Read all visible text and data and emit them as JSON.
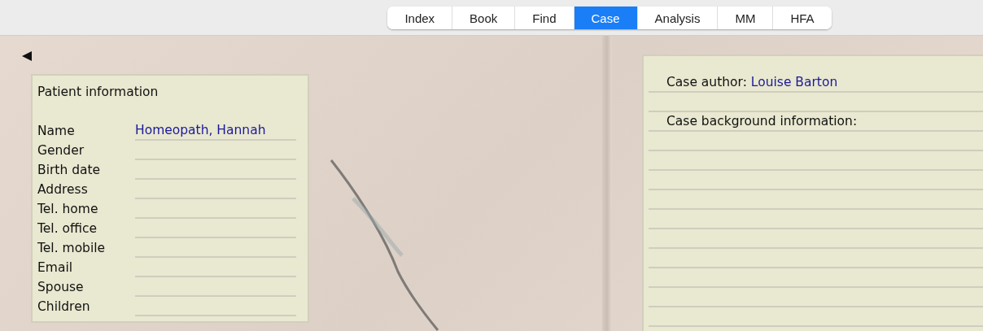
{
  "tabs": [
    {
      "label": "Index",
      "selected": false
    },
    {
      "label": "Book",
      "selected": false
    },
    {
      "label": "Find",
      "selected": false
    },
    {
      "label": "Case",
      "selected": true
    },
    {
      "label": "Analysis",
      "selected": false
    },
    {
      "label": "MM",
      "selected": false
    },
    {
      "label": "HFA",
      "selected": false
    }
  ],
  "patient_information": {
    "title": "Patient information",
    "fields": [
      {
        "label": "Name",
        "value": "Homeopath, Hannah"
      },
      {
        "label": "Gender"
      },
      {
        "label": "Birth date"
      },
      {
        "label": "Address"
      },
      {
        "label": "Tel. home"
      },
      {
        "label": "Tel. office"
      },
      {
        "label": "Tel. mobile"
      },
      {
        "label": "Email"
      },
      {
        "label": "Spouse"
      },
      {
        "label": "Children"
      }
    ]
  },
  "case": {
    "author_label": "Case author:",
    "author": "Louise Barton",
    "background_label": "Case background information:"
  }
}
